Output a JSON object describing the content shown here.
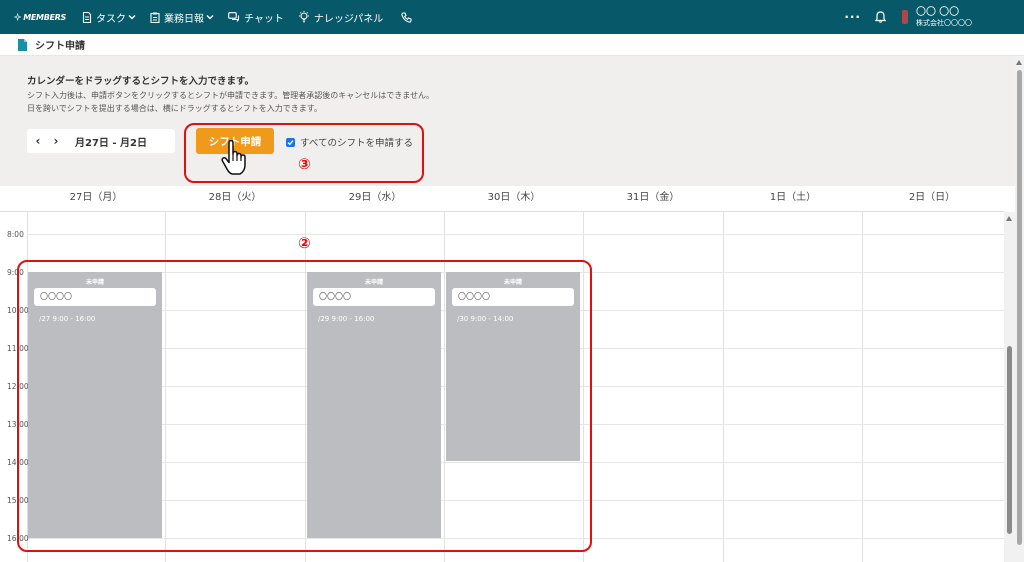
{
  "app": {
    "logo_text": "MEMBERS"
  },
  "nav": {
    "items": [
      {
        "label": "タスク",
        "has_dropdown": true
      },
      {
        "label": "業務日報",
        "has_dropdown": true
      },
      {
        "label": "チャット",
        "has_dropdown": false
      },
      {
        "label": "ナレッジパネル",
        "has_dropdown": false
      }
    ],
    "more_label": "···"
  },
  "user": {
    "name": "〇〇 〇〇",
    "company": "株式会社〇〇〇〇"
  },
  "page": {
    "title": "シフト申請"
  },
  "info": {
    "heading": "カレンダーをドラッグするとシフトを入力できます。",
    "desc1": "シフト入力後は、申請ボタンをクリックするとシフトが申請できます。管理者承認後のキャンセルはできません。",
    "desc2": "日を跨いでシフトを提出する場合は、横にドラッグするとシフトを入力できます。"
  },
  "range": {
    "prev": "‹",
    "next": "›",
    "label": "月27日 - 月2日"
  },
  "submit_button": "シフト申請",
  "apply_all": {
    "label": "すべてのシフトを申請する",
    "checked": true
  },
  "annotations": {
    "calendar_marker": "②",
    "button_marker": "③"
  },
  "calendar": {
    "days": [
      "27日（月）",
      "28日（火）",
      "29日（水）",
      "30日（木）",
      "31日（金）",
      "1日（土）",
      "2日（日）"
    ],
    "times": [
      "8:00",
      "9:00",
      "10:00",
      "11:00",
      "12:00",
      "13:00",
      "14:00",
      "15:00",
      "16:00"
    ],
    "shifts": [
      {
        "status": "未申請",
        "name": "〇〇〇〇",
        "time": "/27 9:00 - 16:00"
      },
      {
        "status": "未申請",
        "name": "〇〇〇〇",
        "time": "/29 9:00 - 16:00"
      },
      {
        "status": "未申請",
        "name": "〇〇〇〇",
        "time": "/30 9:00 - 14:00"
      }
    ]
  },
  "colors": {
    "header": "#07596a",
    "accent": "#f09a1c",
    "annotation": "#e01010",
    "shift": "#bcbdc0"
  }
}
